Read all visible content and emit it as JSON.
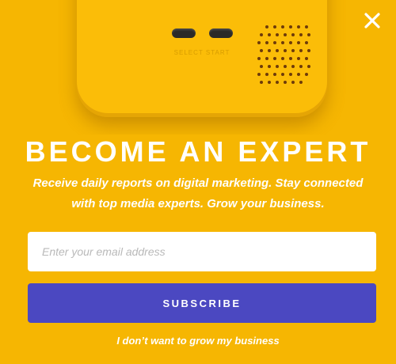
{
  "hero": {
    "device_button_caption": "SELECT START",
    "device_color": "#fbbd08",
    "button_color": "#2b2a28",
    "speaker_dot_color": "#6e3b0a"
  },
  "close": {
    "icon": "close-icon"
  },
  "title": "BECOME AN EXPERT",
  "subtitle": "Receive daily reports on digital marketing. Stay connected with top media experts. Grow your business.",
  "form": {
    "email_placeholder": "Enter your email address",
    "email_value": "",
    "subscribe_label": "SUBSCRIBE"
  },
  "decline_label": "I don’t want to grow my business",
  "colors": {
    "background": "#f6b602",
    "accent": "#4b48c1",
    "text": "#ffffff"
  }
}
